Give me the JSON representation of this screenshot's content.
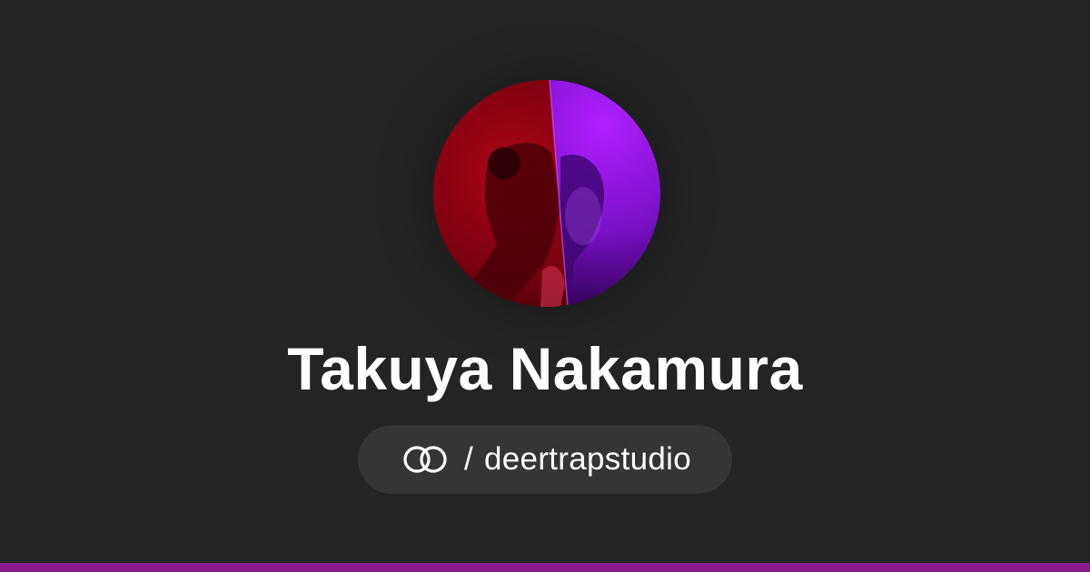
{
  "profile": {
    "name": "Takuya Nakamura",
    "separator": "/",
    "handle": "deertrapstudio",
    "logo_icon": "linked-rings-icon",
    "avatar_description_icon": "avatar-photo"
  },
  "colors": {
    "background": "#242424",
    "pill": "#353535",
    "text": "#ffffff",
    "accent_bar": "#8a1a8c",
    "avatar_red": "#a00010",
    "avatar_purple": "#9a10f0"
  }
}
